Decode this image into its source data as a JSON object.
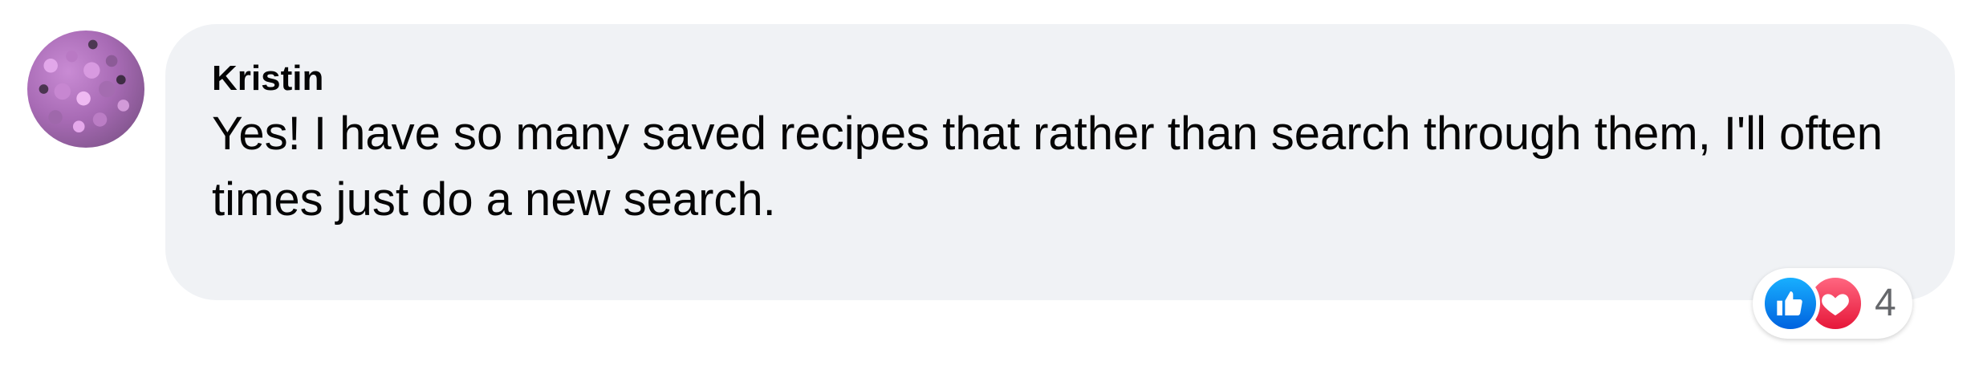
{
  "comment": {
    "author": "Kristin",
    "text": "Yes! I have so many saved recipes that rather than search through them, I'll often times just do a new search.",
    "avatar_icon": "profile-photo-flowers",
    "reactions": {
      "icons": [
        "like-icon",
        "love-icon"
      ],
      "count": "4"
    }
  },
  "colors": {
    "bubble_bg": "#f0f2f5",
    "like_blue": "#0866ff",
    "love_red": "#f33e58",
    "count_gray": "#65676b"
  }
}
